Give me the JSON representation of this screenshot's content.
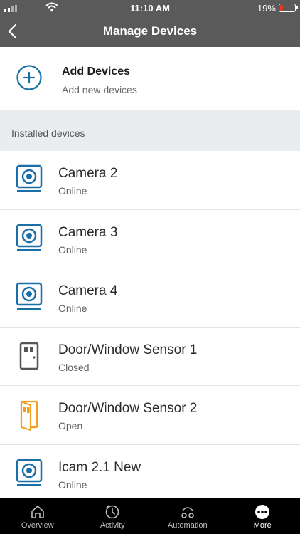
{
  "status_bar": {
    "time": "11:10 AM",
    "battery": "19%"
  },
  "header": {
    "title": "Manage Devices"
  },
  "add_devices": {
    "title": "Add Devices",
    "subtitle": "Add new devices"
  },
  "section_header": "Installed devices",
  "devices": [
    {
      "name": "Camera 2",
      "status": "Online",
      "icon": "camera-icon"
    },
    {
      "name": "Camera 3",
      "status": "Online",
      "icon": "camera-icon"
    },
    {
      "name": "Camera 4",
      "status": "Online",
      "icon": "camera-icon"
    },
    {
      "name": "Door/Window Sensor 1",
      "status": "Closed",
      "icon": "door-closed-icon"
    },
    {
      "name": "Door/Window Sensor 2",
      "status": "Open",
      "icon": "door-open-icon"
    },
    {
      "name": "Icam 2.1 New",
      "status": "Online",
      "icon": "camera-icon"
    }
  ],
  "tabs": [
    {
      "label": "Overview",
      "icon": "home-icon"
    },
    {
      "label": "Activity",
      "icon": "activity-icon"
    },
    {
      "label": "Automation",
      "icon": "automation-icon"
    },
    {
      "label": "More",
      "icon": "more-icon",
      "active": true
    }
  ],
  "colors": {
    "accent": "#1a6fa8",
    "door_open": "#f0a020",
    "header_bg": "#5a5a5a"
  }
}
